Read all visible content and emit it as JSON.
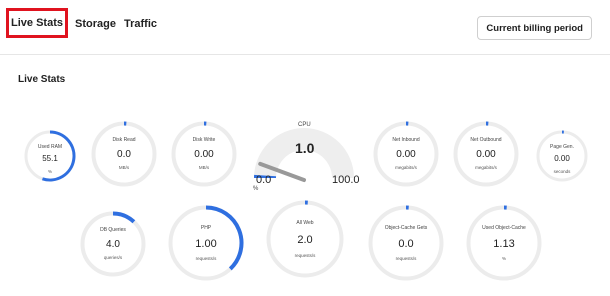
{
  "tabs": [
    {
      "label": "Live Stats",
      "active": true
    },
    {
      "label": "Storage",
      "active": false
    },
    {
      "label": "Traffic",
      "active": false
    }
  ],
  "billing_button": "Current billing period",
  "section_title": "Live Stats",
  "accent_color": "#2f6fe0",
  "highlight_color": "#e0131f",
  "cpu": {
    "label": "CPU",
    "value": "1.0",
    "min": "0.0",
    "max": "100.0",
    "unit": "%",
    "fraction": 0.01
  },
  "gauges_row1": [
    {
      "id": "used-ram",
      "label": "Used RAM",
      "value": "55.1",
      "unit": "%",
      "fraction": 0.551
    },
    {
      "id": "disk-read",
      "label": "Disk Read",
      "value": "0.0",
      "unit": "MB/s",
      "fraction": 0
    },
    {
      "id": "disk-write",
      "label": "Disk Write",
      "value": "0.00",
      "unit": "MB/s",
      "fraction": 0
    },
    {
      "id": "net-inbound",
      "label": "Net Inbound",
      "value": "0.00",
      "unit": "megabits/s",
      "fraction": 0
    },
    {
      "id": "net-outbound",
      "label": "Net Outbound",
      "value": "0.00",
      "unit": "megabits/s",
      "fraction": 0
    },
    {
      "id": "page-gen",
      "label": "Page Gen.",
      "value": "0.00",
      "unit": "seconds",
      "fraction": 0
    }
  ],
  "gauges_row2": [
    {
      "id": "db-queries",
      "label": "DB Queries",
      "value": "4.0",
      "unit": "queries/s",
      "fraction": 0.12
    },
    {
      "id": "php",
      "label": "PHP",
      "value": "1.00",
      "unit": "requests/s",
      "fraction": 0.38
    },
    {
      "id": "all-web",
      "label": "All Web",
      "value": "2.0",
      "unit": "requests/s",
      "fraction": 0.01
    },
    {
      "id": "object-cache-gets",
      "label": "Object-Cache Gets",
      "value": "0.0",
      "unit": "requests/s",
      "fraction": 0
    },
    {
      "id": "used-object-cache",
      "label": "Used Object-Cache",
      "value": "1.13",
      "unit": "%",
      "fraction": 0.011
    }
  ]
}
